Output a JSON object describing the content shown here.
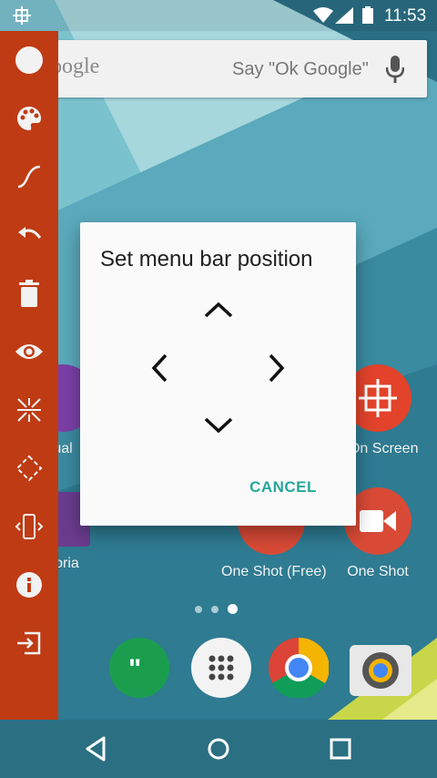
{
  "status_bar": {
    "time": "11:53"
  },
  "search_bar": {
    "brand": "oogle",
    "hint": "Say \"Ok Google\""
  },
  "apps": [
    {
      "label": "ual",
      "color": "#7b3fa8"
    },
    {
      "label": "v On Screen",
      "color": "#e2432a"
    },
    {
      "label": "noria",
      "color": "#6a3c8f"
    },
    {
      "label": "One Shot (Free)",
      "color": "#d84a36"
    },
    {
      "label": "One Shot",
      "color": "#d84a36"
    }
  ],
  "page_indicator": {
    "count": 3,
    "active_index": 2
  },
  "dock": {
    "icons": [
      "hangouts-icon",
      "app-drawer-icon",
      "chrome-icon",
      "camera-icon"
    ]
  },
  "sidebar": {
    "color": "#bf3b13",
    "items": [
      "circle-icon",
      "palette-icon",
      "curve-icon",
      "undo-icon",
      "trash-icon",
      "eye-icon",
      "collapse-arrows-icon",
      "move-icon",
      "phone-rotate-icon",
      "info-icon",
      "exit-icon"
    ]
  },
  "dialog": {
    "title": "Set menu bar position",
    "cancel_label": "CANCEL",
    "accent_color": "#26a69a"
  },
  "nav_bar": {
    "buttons": [
      "back-icon",
      "home-icon",
      "recents-icon"
    ]
  }
}
